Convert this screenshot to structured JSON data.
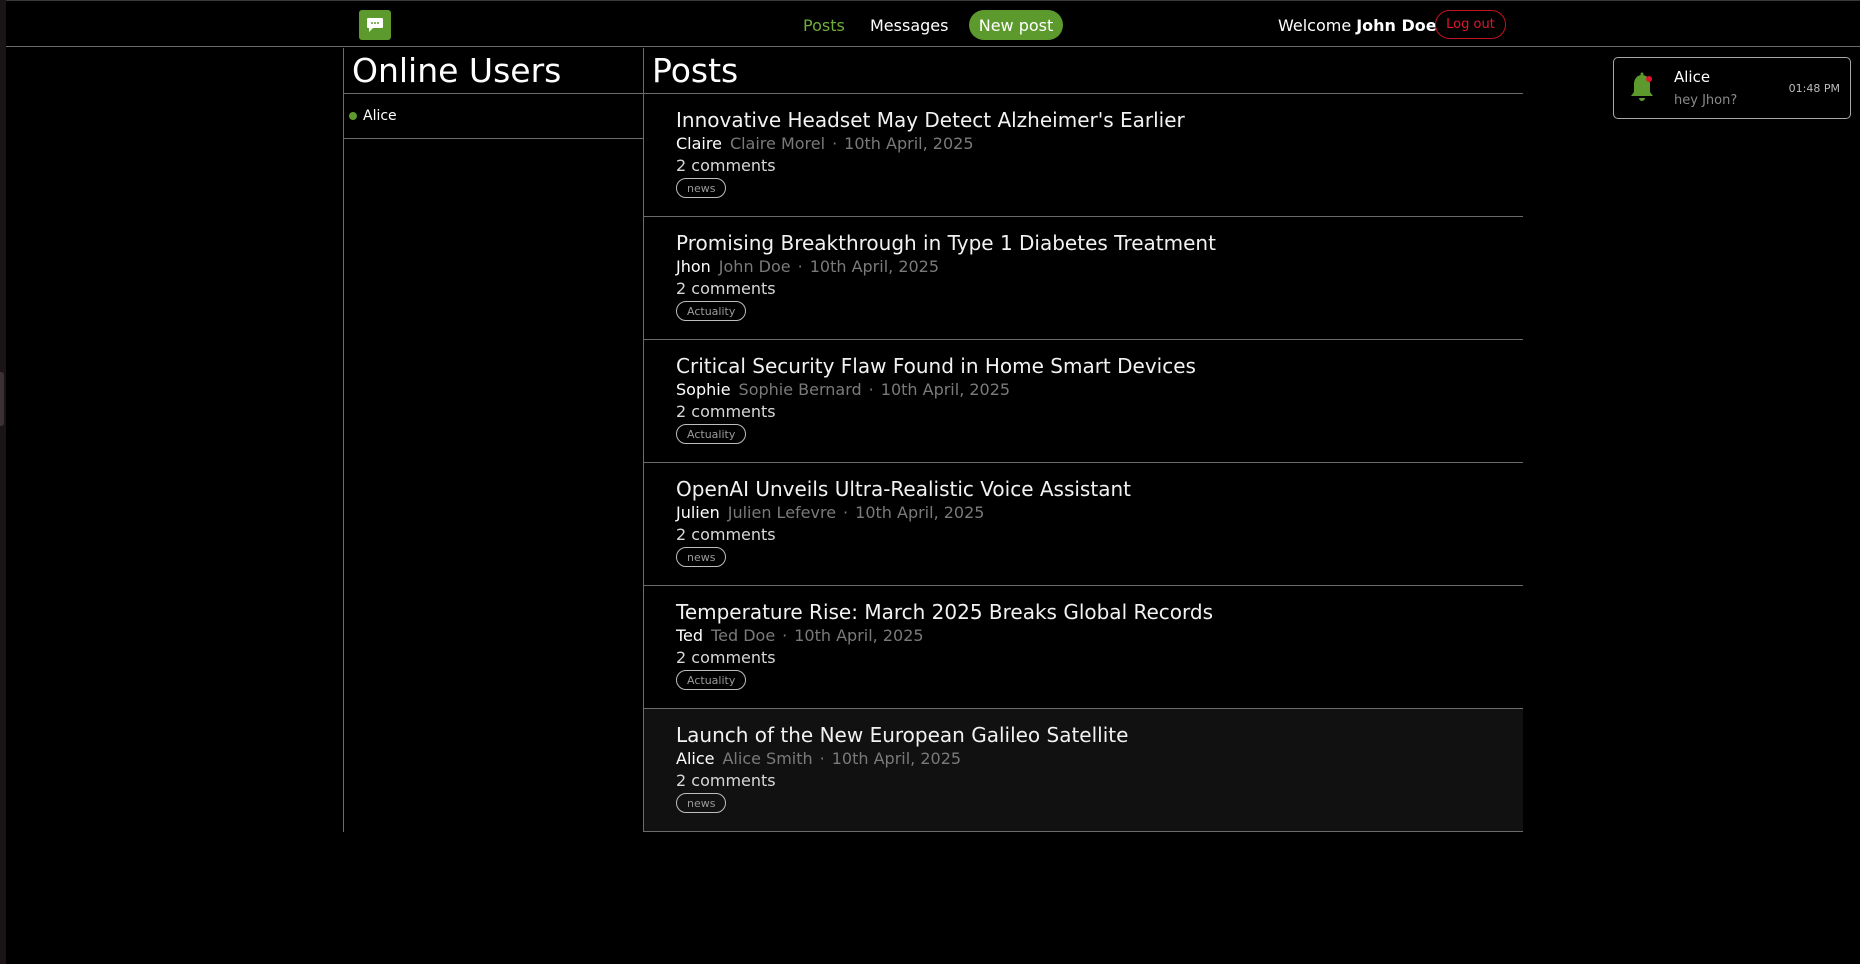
{
  "header": {
    "nav_posts": "Posts",
    "nav_messages": "Messages",
    "new_post": "New post",
    "welcome": "Welcome",
    "user_name": "John Doe",
    "logout": "Log out",
    "logo_icon": "chat-bubble-icon"
  },
  "online": {
    "title": "Online Users",
    "users": [
      "Alice"
    ]
  },
  "posts": {
    "title": "Posts",
    "items": [
      {
        "title": "Innovative Headset May Detect Alzheimer's Earlier",
        "username": "Claire",
        "fullname": "Claire Morel",
        "sep": "·",
        "date": "10th April, 2025",
        "comments": "2 comments",
        "tag": "news"
      },
      {
        "title": "Promising Breakthrough in Type 1 Diabetes Treatment",
        "username": "Jhon",
        "fullname": "John Doe",
        "sep": "·",
        "date": "10th April, 2025",
        "comments": "2 comments",
        "tag": "Actuality"
      },
      {
        "title": "Critical Security Flaw Found in Home Smart Devices",
        "username": "Sophie",
        "fullname": "Sophie Bernard",
        "sep": "·",
        "date": "10th April, 2025",
        "comments": "2 comments",
        "tag": "Actuality"
      },
      {
        "title": "OpenAI Unveils Ultra-Realistic Voice Assistant",
        "username": "Julien",
        "fullname": "Julien Lefevre",
        "sep": "·",
        "date": "10th April, 2025",
        "comments": "2 comments",
        "tag": "news"
      },
      {
        "title": "Temperature Rise: March 2025 Breaks Global Records",
        "username": "Ted",
        "fullname": "Ted Doe",
        "sep": "·",
        "date": "10th April, 2025",
        "comments": "2 comments",
        "tag": "Actuality"
      },
      {
        "title": "Launch of the New European Galileo Satellite",
        "username": "Alice",
        "fullname": "Alice Smith",
        "sep": "·",
        "date": "10th April, 2025",
        "comments": "2 comments",
        "tag": "news"
      }
    ]
  },
  "notification": {
    "name": "Alice",
    "message": "hey Jhon?",
    "time": "01:48 PM",
    "icon": "bell-icon"
  },
  "colors": {
    "accent": "#5c9a2e",
    "logout": "#e0162b",
    "background": "#000000"
  }
}
